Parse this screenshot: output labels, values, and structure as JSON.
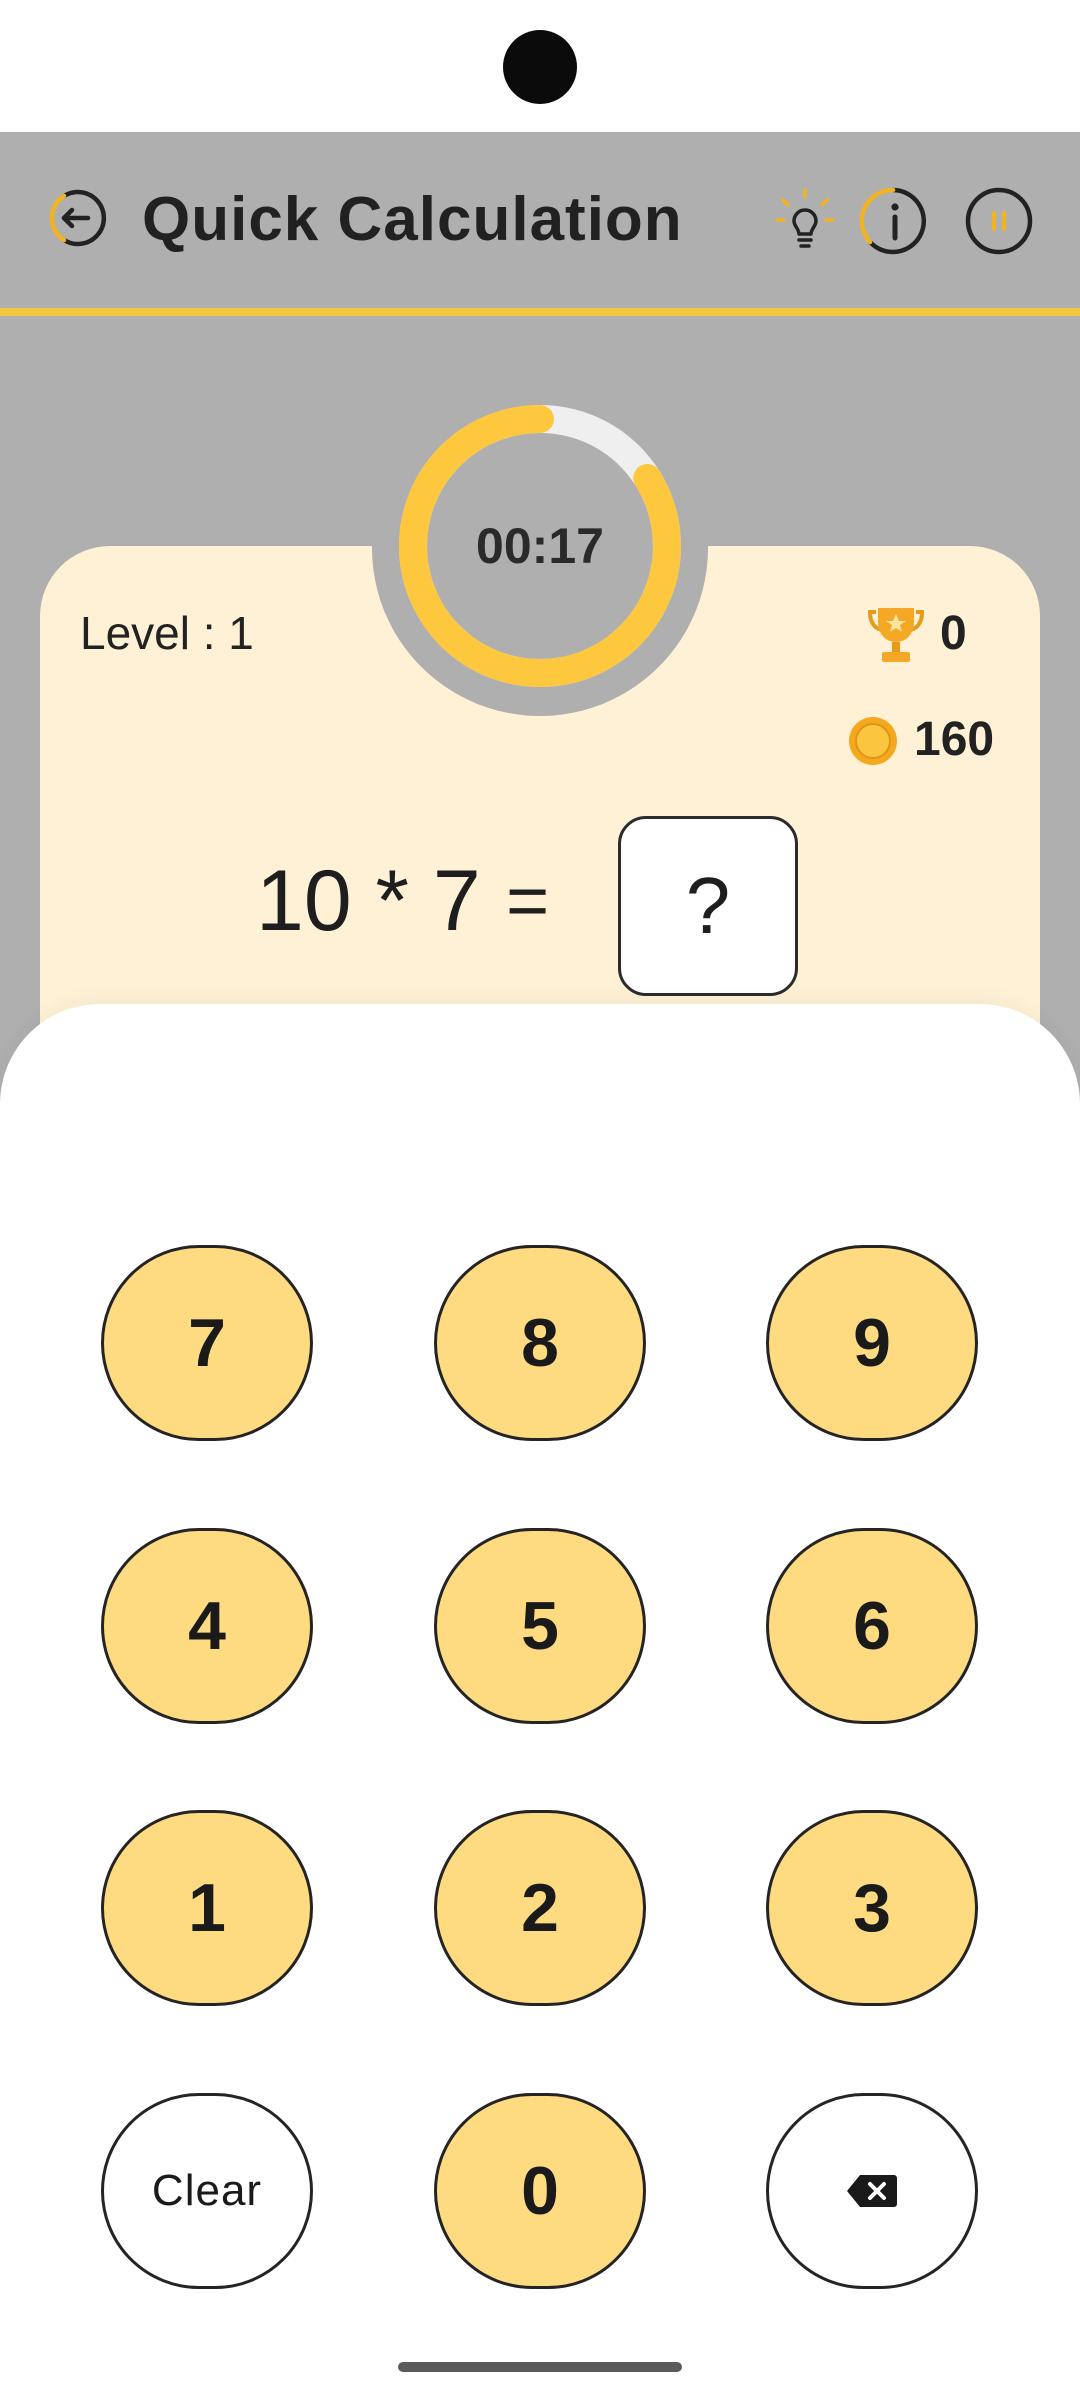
{
  "status_bar": {
    "time": "",
    "icons": ""
  },
  "app_bar": {
    "title": "Quick Calculation",
    "back_icon": "back-arrow-icon",
    "hint_icon": "lightbulb-icon",
    "info_icon": "info-icon",
    "pause_icon": "pause-icon",
    "accent_color": "#f2c840"
  },
  "game": {
    "timer": "00:17",
    "timer_progress": 0.84,
    "level": "Level : 1",
    "trophy_count": "0",
    "coin_count": "160",
    "equation": "10 * 7",
    "equals": "=",
    "answer_placeholder": "?"
  },
  "keypad": {
    "keys": [
      "7",
      "8",
      "9",
      "4",
      "5",
      "6",
      "1",
      "2",
      "3",
      "Clear",
      "0",
      "backspace"
    ],
    "backspace_icon": "backspace-icon",
    "key_color": "#fedb80"
  }
}
